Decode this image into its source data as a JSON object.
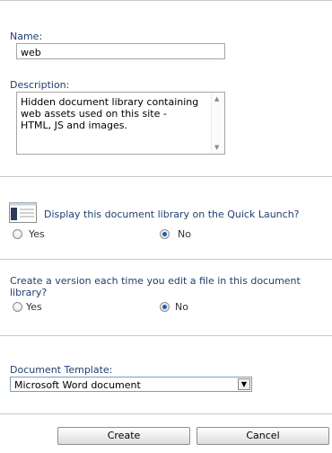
{
  "name_section": {
    "name_label": "Name:",
    "name_value": "web",
    "description_label": "Description:",
    "description_value": "Hidden document library containing\nweb assets used on this site -\nHTML, JS and images."
  },
  "quick_launch": {
    "question": "Display this document library on the Quick Launch?",
    "yes_label": "Yes",
    "no_label": "No",
    "selected": "No"
  },
  "versioning": {
    "question": "Create a version each time you edit a file in this document library?",
    "yes_label": "Yes",
    "no_label": "No",
    "selected": "No"
  },
  "template": {
    "label": "Document Template:",
    "selected": "Microsoft Word document"
  },
  "buttons": {
    "create": "Create",
    "cancel": "Cancel"
  },
  "icons": {
    "quick_launch": "quick-launch-icon",
    "scroll_up": "scroll-up-icon",
    "scroll_down": "scroll-down-icon",
    "dropdown": "chevron-down-icon"
  }
}
